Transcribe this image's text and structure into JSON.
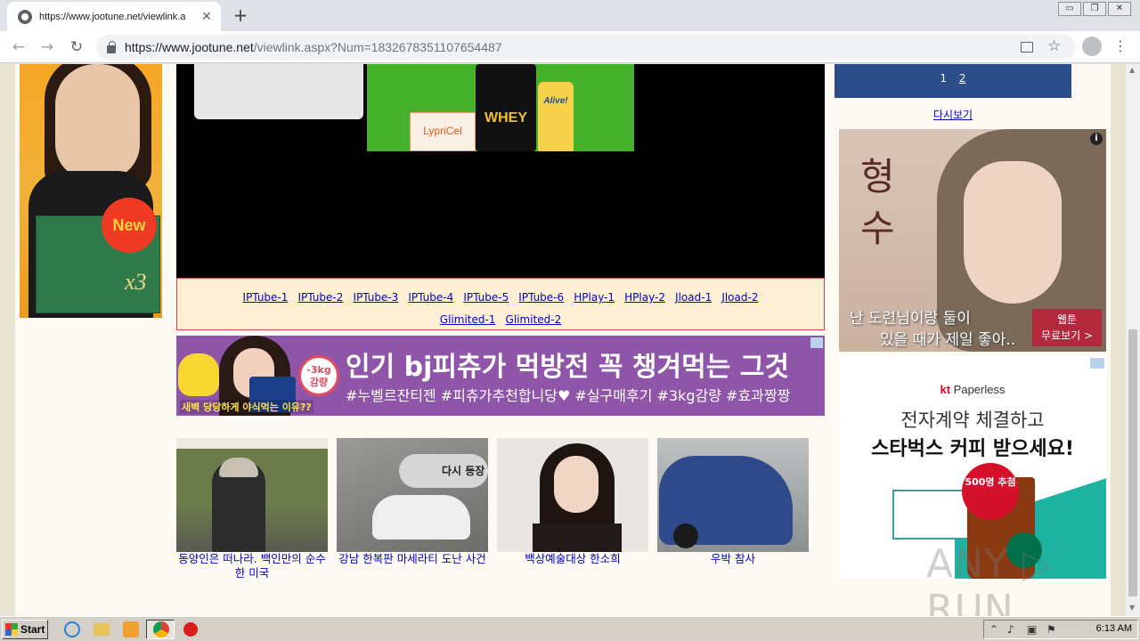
{
  "browser": {
    "tab_title": "https://www.jootune.net/viewlink.a",
    "tab_close": "✕",
    "new_tab": "+",
    "url_host": "https://www.jootune.net",
    "url_path": "/viewlink.aspx?Num=1832678351107654487",
    "back": "←",
    "forward": "→",
    "reload": "↻",
    "star": "☆",
    "menu": "⋮",
    "window_controls": [
      "▭",
      "❐",
      "✕"
    ]
  },
  "left_ad": {
    "badge": "New",
    "mark": "x3"
  },
  "product_ad": {
    "whey": "WHEY",
    "alive": "Alive!",
    "lypricel": "LypriCel"
  },
  "links": {
    "row1": [
      "IPTube-1",
      "IPTube-2",
      "IPTube-3",
      "IPTube-4",
      "IPTube-5",
      "IPTube-6",
      "HPlay-1",
      "HPlay-2",
      "Jload-1",
      "Jload-2"
    ],
    "row2": [
      "Glimited-1",
      "Glimited-2"
    ]
  },
  "banner": {
    "headline": "인기 bj피츄가 먹방전 꼭 챙겨먹는 그것",
    "tags": "#누벨르잔티젠 #피츄가추천합니당♥ #실구매후기 #3kg감량 #효과짱짱",
    "badge": "-3kg 감량",
    "subtitle": "새벽 당당하게 야식먹는 이유??"
  },
  "thumbnails": [
    {
      "caption": "동양인은 떠나라. 백인만의 순수한 미국"
    },
    {
      "caption": "강남 한복판 마세라티 도난 사건",
      "overlay": "다시 등장"
    },
    {
      "caption": "백상예술대상 한소희"
    },
    {
      "caption": "우박 참사"
    }
  ],
  "pager": {
    "pages": [
      "1",
      "2"
    ],
    "reload_label": "다시보기"
  },
  "webtoon_ad": {
    "title_chars": [
      "형",
      "수"
    ],
    "line1": "난 도련님이랑 둘이",
    "line2": "있을 때가 제일 좋아..",
    "cta": "웹툰\n무료보기 >",
    "info": "i"
  },
  "kt_ad": {
    "brand_kt": "kt",
    "brand_name": " Paperless",
    "line1": "전자계약 체결하고",
    "line2": "스타벅스 커피 받으세요!",
    "seal": "500명 추첨"
  },
  "watermark": "ANY ▷ RUN",
  "taskbar": {
    "start": "Start",
    "time": "6:13 AM"
  },
  "colors": {
    "banner_purple": "#8f55a8",
    "pager_blue": "#2b4e88",
    "link_blue": "#0000cc",
    "links_border": "#d84444"
  }
}
